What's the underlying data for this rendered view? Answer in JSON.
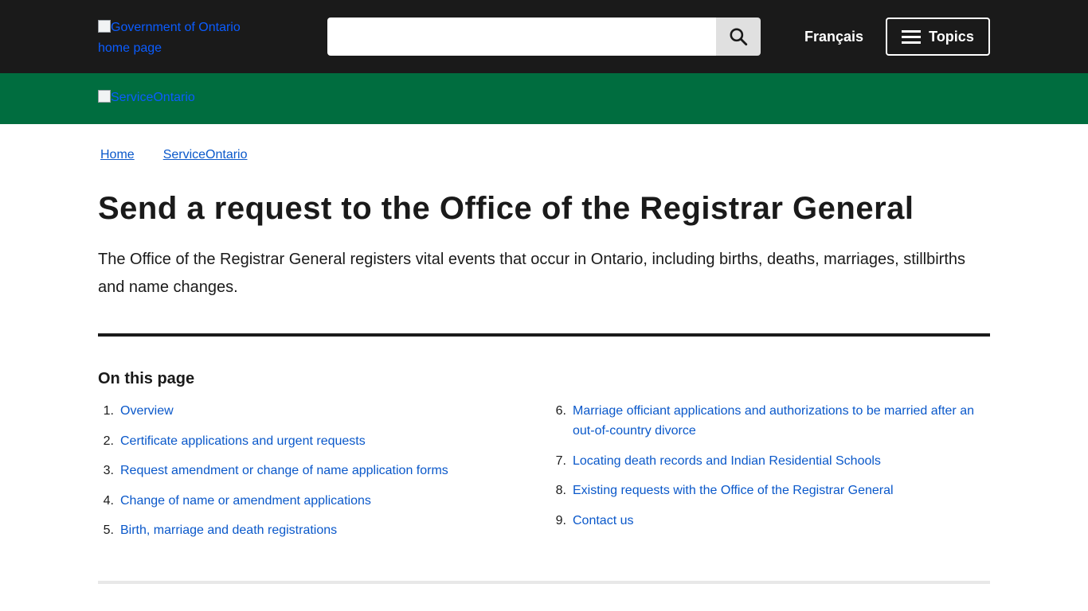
{
  "header": {
    "logo_alt": "Government of Ontario home page",
    "search": {
      "value": "",
      "placeholder": "",
      "button_icon": "search-icon"
    },
    "language_link": "Français",
    "topics_button": "Topics",
    "colors": {
      "topbar": "#1a1a1a",
      "greenbar": "#006d3f"
    }
  },
  "subheader": {
    "logo_alt": "ServiceOntario"
  },
  "breadcrumb": [
    "Home",
    "ServiceOntario"
  ],
  "page": {
    "title": "Send a request to the Office of the Registrar General",
    "lead": "The Office of the Registrar General registers vital events that occur in Ontario, including births, deaths, marriages, stillbirths and name changes."
  },
  "toc": {
    "heading": "On this page",
    "items": [
      {
        "num": "1.",
        "label": "Overview"
      },
      {
        "num": "2.",
        "label": "Certificate applications and urgent requests"
      },
      {
        "num": "3.",
        "label": "Request amendment or change of name application forms"
      },
      {
        "num": "4.",
        "label": "Change of name or amendment applications"
      },
      {
        "num": "5.",
        "label": "Birth, marriage and death registrations"
      },
      {
        "num": "6.",
        "label": "Marriage officiant applications and authorizations to be married after an out-of-country divorce"
      },
      {
        "num": "7.",
        "label": "Locating death records and Indian Residential Schools"
      },
      {
        "num": "8.",
        "label": "Existing requests with the Office of the Registrar General"
      },
      {
        "num": "9.",
        "label": "Contact us"
      }
    ]
  }
}
